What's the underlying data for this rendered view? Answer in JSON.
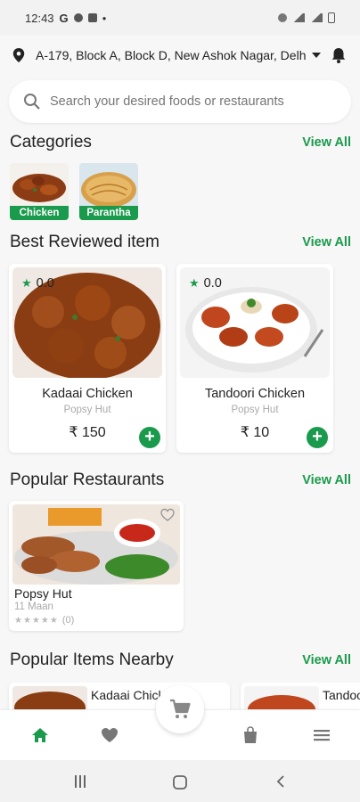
{
  "status_bar": {
    "time": "12:43",
    "left_glyph": "G"
  },
  "header": {
    "address": "A-179, Block A, Block D, New Ashok Nagar, Delhi",
    "location_icon": "location-pin-icon",
    "notification_icon": "bell-icon"
  },
  "search": {
    "placeholder": "Search your desired foods or restaurants"
  },
  "categories": {
    "title": "Categories",
    "view_all": "View All",
    "items": [
      {
        "label": "Chicken"
      },
      {
        "label": "Parantha"
      }
    ]
  },
  "best_reviewed": {
    "title": "Best Reviewed item",
    "view_all": "View All",
    "items": [
      {
        "rating": "0.0",
        "name": "Kadaai Chicken",
        "restaurant": "Popsy Hut",
        "price": "₹ 150"
      },
      {
        "rating": "0.0",
        "name": "Tandoori Chicken",
        "restaurant": "Popsy Hut",
        "price": "₹ 10"
      }
    ]
  },
  "popular_restaurants": {
    "title": "Popular Restaurants",
    "view_all": "View All",
    "items": [
      {
        "name": "Popsy Hut",
        "location": "11 Maan",
        "stars": "★★★★★",
        "reviews": "(0)"
      }
    ]
  },
  "popular_nearby": {
    "title": "Popular Items Nearby",
    "view_all": "View All",
    "items": [
      {
        "name": "Kadaai Chicken"
      },
      {
        "name": "Tandoori Chicken"
      }
    ]
  },
  "bottom_nav": {
    "items": [
      "home-icon",
      "heart-icon",
      "cart-icon",
      "bag-icon",
      "menu-icon"
    ],
    "active": "home"
  },
  "colors": {
    "accent": "#1a9a4c",
    "background": "#f7f7f7",
    "muted": "#aaaaaa"
  }
}
